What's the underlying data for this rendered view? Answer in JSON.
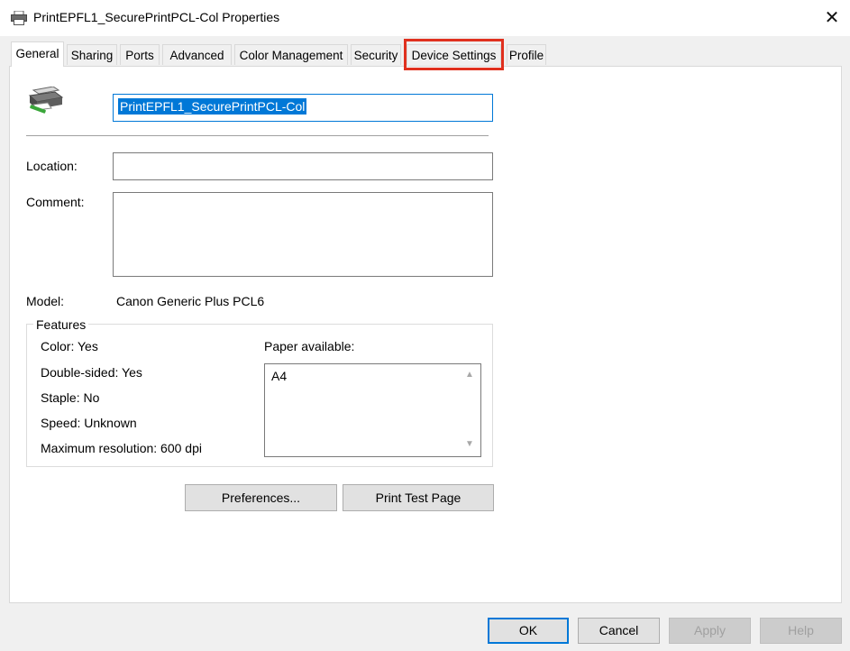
{
  "window": {
    "title": "PrintEPFL1_SecurePrintPCL-Col Properties",
    "close_glyph": "✕",
    "icon": "printer-icon"
  },
  "tabs": [
    {
      "label": "General",
      "active": true
    },
    {
      "label": "Sharing"
    },
    {
      "label": "Ports"
    },
    {
      "label": "Advanced"
    },
    {
      "label": "Color Management"
    },
    {
      "label": "Security"
    },
    {
      "label": "Device Settings",
      "highlighted": true
    },
    {
      "label": "Profile"
    }
  ],
  "general": {
    "printer_name": "PrintEPFL1_SecurePrintPCL-Col",
    "location_label": "Location:",
    "location_value": "",
    "comment_label": "Comment:",
    "comment_value": "",
    "model_label": "Model:",
    "model_value": "Canon Generic Plus PCL6",
    "features": {
      "title": "Features",
      "color": "Color: Yes",
      "double_sided": "Double-sided: Yes",
      "staple": "Staple: No",
      "speed": "Speed: Unknown",
      "max_resolution": "Maximum resolution: 600 dpi",
      "paper_label": "Paper available:",
      "paper_items": [
        "A4"
      ]
    },
    "preferences_label": "Preferences...",
    "print_test_label": "Print Test Page"
  },
  "buttons": {
    "ok": "OK",
    "cancel": "Cancel",
    "apply": "Apply",
    "help": "Help"
  },
  "colors": {
    "accent": "#0078d7",
    "highlight_box": "#e0301e"
  }
}
